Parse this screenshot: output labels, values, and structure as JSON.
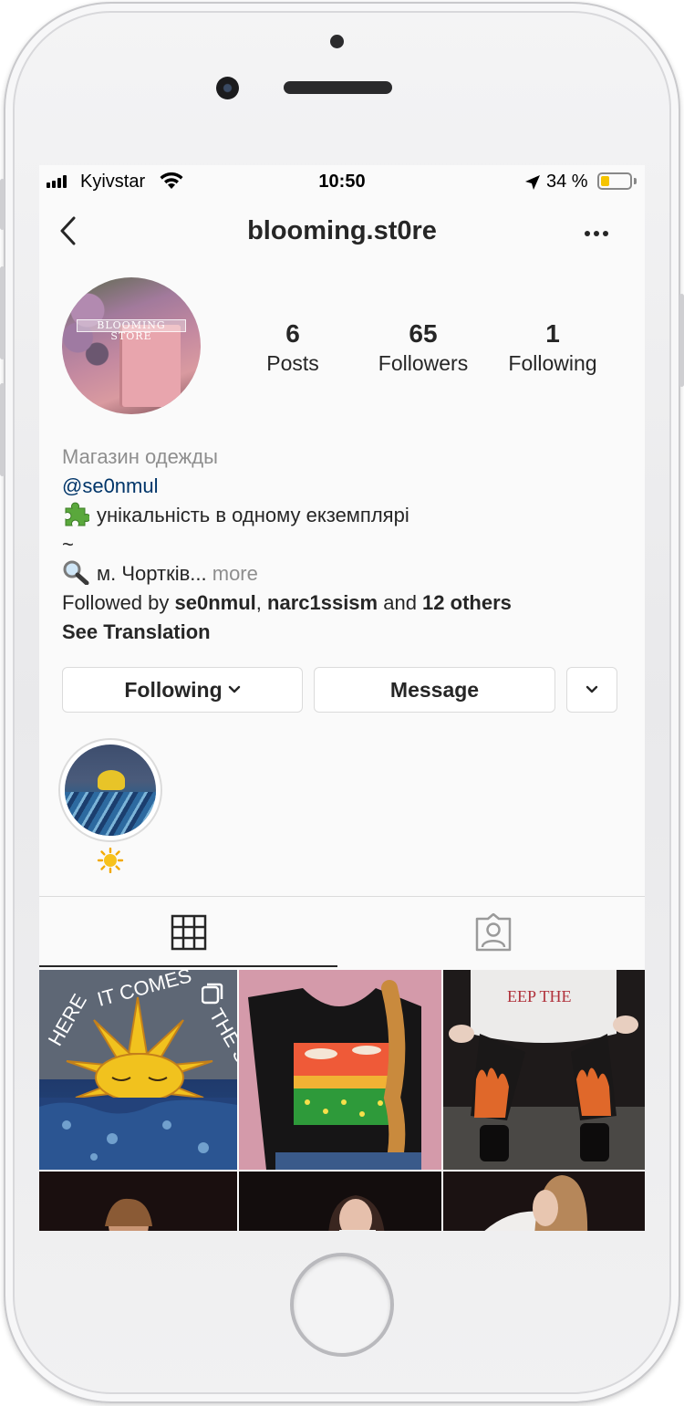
{
  "status_bar": {
    "carrier": "Kyivstar",
    "time": "10:50",
    "battery_percent": "34 %",
    "battery_level": 0.34
  },
  "nav": {
    "title": "blooming.st0re",
    "back_icon": "chevron-left-icon",
    "more_icon": "ellipsis-icon"
  },
  "profile": {
    "avatar_text": "BLOOMING STORE",
    "stats": [
      {
        "value": "6",
        "label": "Posts"
      },
      {
        "value": "65",
        "label": "Followers"
      },
      {
        "value": "1",
        "label": "Following"
      }
    ]
  },
  "bio": {
    "category": "Магазин одежды",
    "mention": "@se0nmul",
    "line1": "унікальність в одному екземплярі",
    "line2": "~",
    "line3": "м. Чортків...",
    "more": " more",
    "followed_by_prefix": "Followed by ",
    "followed_user_1": "se0nmul",
    "followed_sep": ", ",
    "followed_user_2": "narc1ssism",
    "followed_and": " and ",
    "followed_others": "12 others",
    "see_translation": "See Translation"
  },
  "actions": {
    "following_label": "Following",
    "message_label": "Message",
    "dropdown_icon": "chevron-down-icon"
  },
  "highlights": [
    {
      "title": "☀️",
      "icon": "sun-emoji"
    }
  ],
  "tabs": [
    {
      "name": "grid",
      "icon": "grid-icon",
      "active": true
    },
    {
      "name": "tagged",
      "icon": "tagged-person-icon",
      "active": false
    }
  ],
  "grid_posts": [
    {
      "description": "hand-painted jacket with sun",
      "multi": true
    },
    {
      "description": "painted t-shirt"
    },
    {
      "description": "flame-painted jeans"
    },
    {
      "description": "portrait"
    },
    {
      "description": "portrait"
    },
    {
      "description": "portrait"
    }
  ]
}
